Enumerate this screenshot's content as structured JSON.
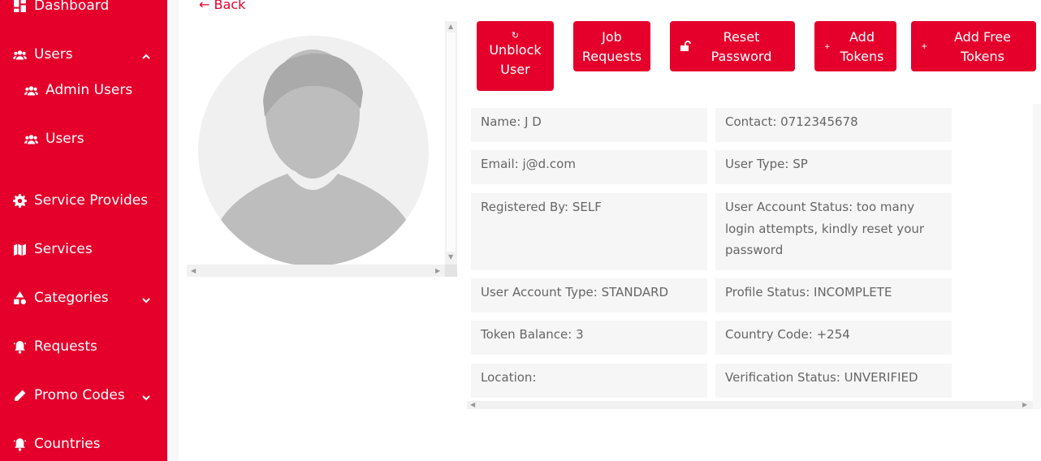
{
  "sidebar": {
    "items": [
      {
        "label": "Dashboard",
        "icon": "dashboard-icon"
      },
      {
        "label": "Users",
        "icon": "users-icon",
        "expanded": true
      },
      {
        "label": "Admin Users",
        "icon": "user-group-icon"
      },
      {
        "label": "Users",
        "icon": "user-group-icon"
      },
      {
        "label": "Service Provides",
        "icon": "gear-icon"
      },
      {
        "label": "Services",
        "icon": "map-icon"
      },
      {
        "label": "Categories",
        "icon": "shapes-icon"
      },
      {
        "label": "Requests",
        "icon": "bell-icon"
      },
      {
        "label": "Promo Codes",
        "icon": "pencil-icon"
      },
      {
        "label": "Countries",
        "icon": "bell-icon"
      }
    ]
  },
  "back_link": "← Back",
  "actions": {
    "unblock_user": "Unblock\nUser",
    "job_requests": "Job\nRequests",
    "reset_password": "Reset\nPassword",
    "add_tokens": "Add\nTokens",
    "add_free_tokens": "Add Free\nTokens"
  },
  "user_info": {
    "name": "Name: J D",
    "contact": "Contact: 0712345678",
    "email": "Email: j@d.com",
    "user_type": "User Type: SP",
    "registered_by": "Registered By: SELF",
    "account_status": "User Account Status: too many login attempts, kindly reset your password",
    "account_type": "User Account Type: STANDARD",
    "profile_status": "Profile Status: INCOMPLETE",
    "token_balance": "Token Balance: 3",
    "country_code": "Country Code: +254",
    "location": "Location:",
    "verification_status": "Verification Status: UNVERIFIED"
  },
  "colors": {
    "brand": "#e4002b",
    "cell_bg": "#f6f6f6",
    "avatar_bg": "#f0f0f0",
    "avatar_fg": "#bdbdbd"
  }
}
